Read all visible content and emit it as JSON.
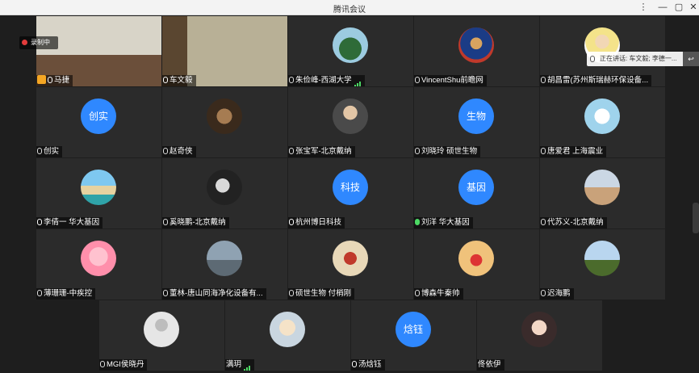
{
  "window": {
    "title": "腾讯会议",
    "recording": "录制中",
    "speaking_label": "正在讲话: 车文毅; 李德一..."
  },
  "participants": [
    {
      "name": "马捷",
      "avatar": "video",
      "host": true,
      "mic": "on"
    },
    {
      "name": "车文毅",
      "avatar": "video",
      "mic": "on",
      "active": true
    },
    {
      "name": "朱俭峰-西湖大学",
      "avatar": "photo",
      "mic": "off",
      "signal": true
    },
    {
      "name": "VincentShu前瞻网",
      "avatar": "photo",
      "mic": "off"
    },
    {
      "name": "胡昌雷(苏州斯瑞赫环保设备...",
      "avatar": "photo",
      "mic": "off"
    },
    {
      "name": "创实",
      "avatar": "text",
      "avatar_text": "创实",
      "mic": "off"
    },
    {
      "name": "赵奇侠",
      "avatar": "photo",
      "mic": "off"
    },
    {
      "name": "张宝军-北京戴纳",
      "avatar": "photo",
      "mic": "off"
    },
    {
      "name": "刘晓玲 硕世生物",
      "avatar": "text",
      "avatar_text": "生物",
      "mic": "off"
    },
    {
      "name": "唐爱君 上海震业",
      "avatar": "photo",
      "mic": "off"
    },
    {
      "name": "李倩一 华大基因",
      "avatar": "photo",
      "mic": "on"
    },
    {
      "name": "奚晓鹏-北京戴纳",
      "avatar": "photo",
      "mic": "off"
    },
    {
      "name": "杭州博日科技",
      "avatar": "text",
      "avatar_text": "科技",
      "mic": "on"
    },
    {
      "name": "刘洋 华大基因",
      "avatar": "text",
      "avatar_text": "基因",
      "mic": "green"
    },
    {
      "name": "代苏义-北京戴纳",
      "avatar": "photo",
      "mic": "off"
    },
    {
      "name": "薄珊珊-中疾控",
      "avatar": "photo",
      "mic": "off"
    },
    {
      "name": "董林-唐山同海净化设备有...",
      "avatar": "photo",
      "mic": "off"
    },
    {
      "name": "硕世生物 付梢刚",
      "avatar": "photo",
      "mic": "off"
    },
    {
      "name": "博森牛秦帅",
      "avatar": "photo",
      "mic": "off"
    },
    {
      "name": "迟海鹏",
      "avatar": "photo",
      "mic": "off"
    },
    {
      "name": "MGI侯晓丹",
      "avatar": "default",
      "mic": "off"
    },
    {
      "name": "满玥",
      "avatar": "photo",
      "mic": "none",
      "signal": true
    },
    {
      "name": "汤焓钰",
      "avatar": "text",
      "avatar_text": "焓钰",
      "mic": "on"
    },
    {
      "name": "佟依伊",
      "avatar": "photo",
      "mic": "none"
    }
  ]
}
